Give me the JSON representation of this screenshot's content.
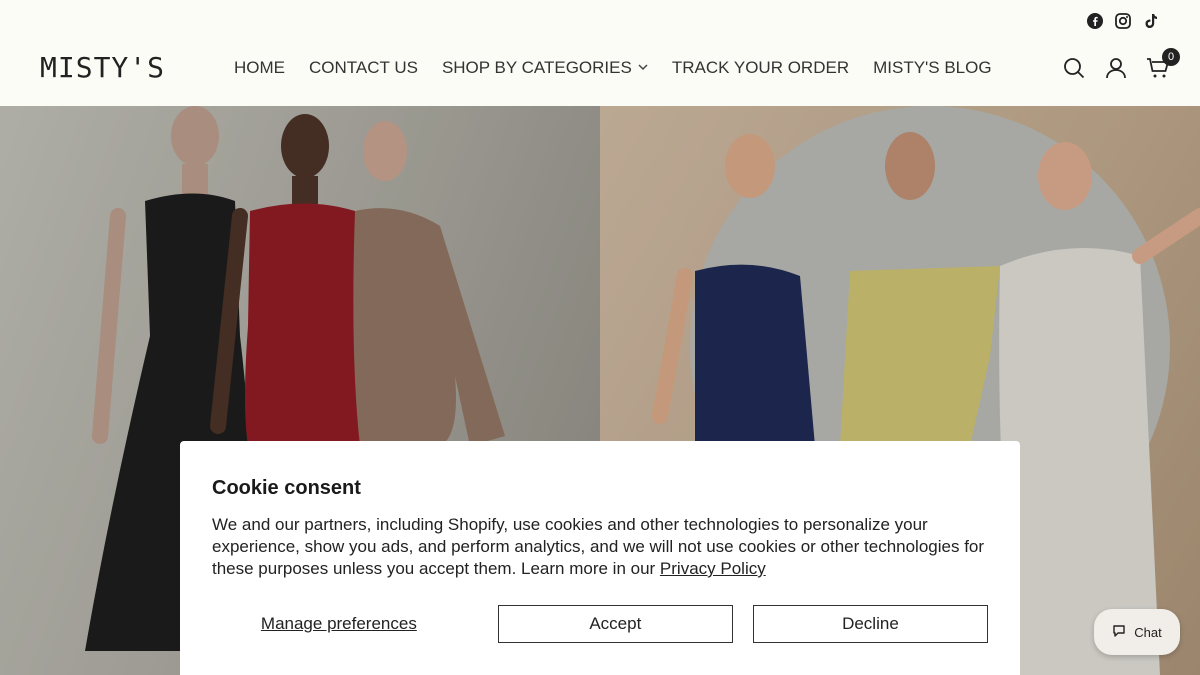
{
  "header": {
    "logo": "MISTY'S",
    "nav": [
      {
        "label": "HOME"
      },
      {
        "label": "CONTACT US"
      },
      {
        "label": "SHOP BY CATEGORIES",
        "has_dropdown": true
      },
      {
        "label": "TRACK YOUR ORDER"
      },
      {
        "label": "MISTY'S BLOG"
      }
    ],
    "social_icons": [
      "facebook-icon",
      "instagram-icon",
      "tiktok-icon"
    ],
    "cart_count": "0"
  },
  "cookie": {
    "title": "Cookie consent",
    "body": "We and our partners, including Shopify, use cookies and other technologies to personalize your experience, show you ads, and perform analytics, and we will not use cookies or other technologies for these purposes unless you accept them. Learn more in our ",
    "link": "Privacy Policy",
    "manage_label": "Manage preferences",
    "accept_label": "Accept",
    "decline_label": "Decline"
  },
  "chat": {
    "label": "Chat"
  },
  "colors": {
    "header_bg": "#fcfcf7",
    "text": "#222222"
  }
}
